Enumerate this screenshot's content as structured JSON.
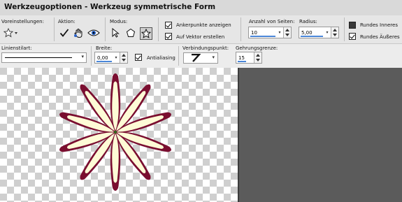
{
  "window": {
    "title": "Werkzeugoptionen - Werkzeug symmetrische Form"
  },
  "toolbar1": {
    "presets_label": "Voreinstellungen:",
    "action_label": "Aktion:",
    "mode_label": "Modus:",
    "anchor_points_label": "Ankerpunkte anzeigen",
    "anchor_points_checked": true,
    "on_vector_label": "Auf Vektor erstellen",
    "on_vector_checked": true,
    "sides_label": "Anzahl von Seiten:",
    "sides_value": "10",
    "radius_label": "Radius:",
    "radius_value": "5,00",
    "round_inner_label": "Rundes Inneres",
    "round_inner_checked": false,
    "round_outer_label": "Rundes Äußeres",
    "round_outer_checked": true
  },
  "toolbar2": {
    "line_style_label": "Linienstilart:",
    "width_label": "Breite:",
    "width_value": "0,00",
    "antialias_label": "Antialiasing",
    "antialias_checked": true,
    "join_label": "Verbindungspunkt:",
    "miter_label": "Gehrungsgrenze:",
    "miter_value": "15"
  },
  "canvas": {
    "shape": "flower-10-petals",
    "petal_fill": "#fefbd6",
    "petal_stroke": "#7a0e30",
    "center_color": "#2f6a18",
    "workspace_color": "#5b5b5b"
  },
  "icons": [
    "star-preset-icon",
    "apply-check-icon",
    "hand-drag-icon",
    "eye-icon",
    "pen-node-icon",
    "pentagon-icon",
    "star-mode-icon",
    "miter-join-icon"
  ]
}
